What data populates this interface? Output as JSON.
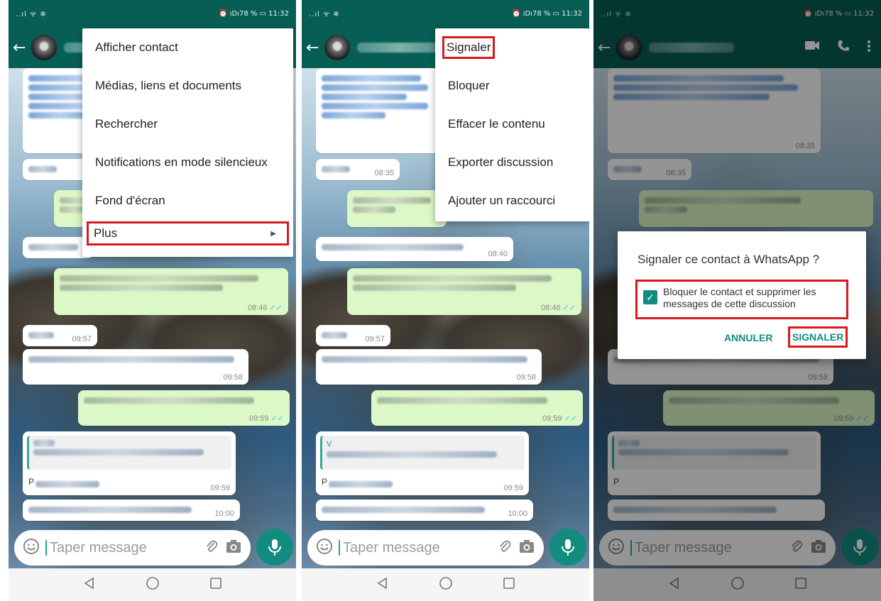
{
  "status": {
    "signal": "..ıl ᯤ ✲",
    "right": "⏰ ıDı78 % ▭ 11:32"
  },
  "input": {
    "placeholder": "Taper message"
  },
  "times": {
    "t0835": "08:35",
    "t0840": "08:40",
    "t0846": "08:46",
    "t0957": "09:57",
    "t0958": "09:58",
    "t0959": "09:59",
    "t1000": "10:00"
  },
  "quote": {
    "v": "V",
    "t": "T",
    "p": "P",
    "l": "Lé"
  },
  "menu1": {
    "items": [
      "Afficher contact",
      "Médias, liens et documents",
      "Rechercher",
      "Notifications en mode silencieux",
      "Fond d'écran",
      "Plus"
    ]
  },
  "menu2": {
    "items": [
      "Signaler",
      "Bloquer",
      "Effacer le contenu",
      "Exporter discussion",
      "Ajouter un raccourci"
    ]
  },
  "dialog": {
    "title": "Signaler ce contact à WhatsApp ?",
    "checkbox": "Bloquer le contact et supprimer les messages de cette discussion",
    "cancel": "ANNULER",
    "confirm": "SIGNALER"
  },
  "colors": {
    "header": "#075e54",
    "accent": "#128c7e",
    "highlight": "#d71920",
    "outgoing": "#dcf8c6"
  },
  "icons": [
    "back-arrow-icon",
    "video-call-icon",
    "phone-icon",
    "more-vert-icon",
    "emoji-icon",
    "attach-icon",
    "camera-icon",
    "mic-icon",
    "nav-back-icon",
    "nav-home-icon",
    "nav-recents-icon",
    "checkbox-checked-icon",
    "submenu-arrow-icon"
  ]
}
